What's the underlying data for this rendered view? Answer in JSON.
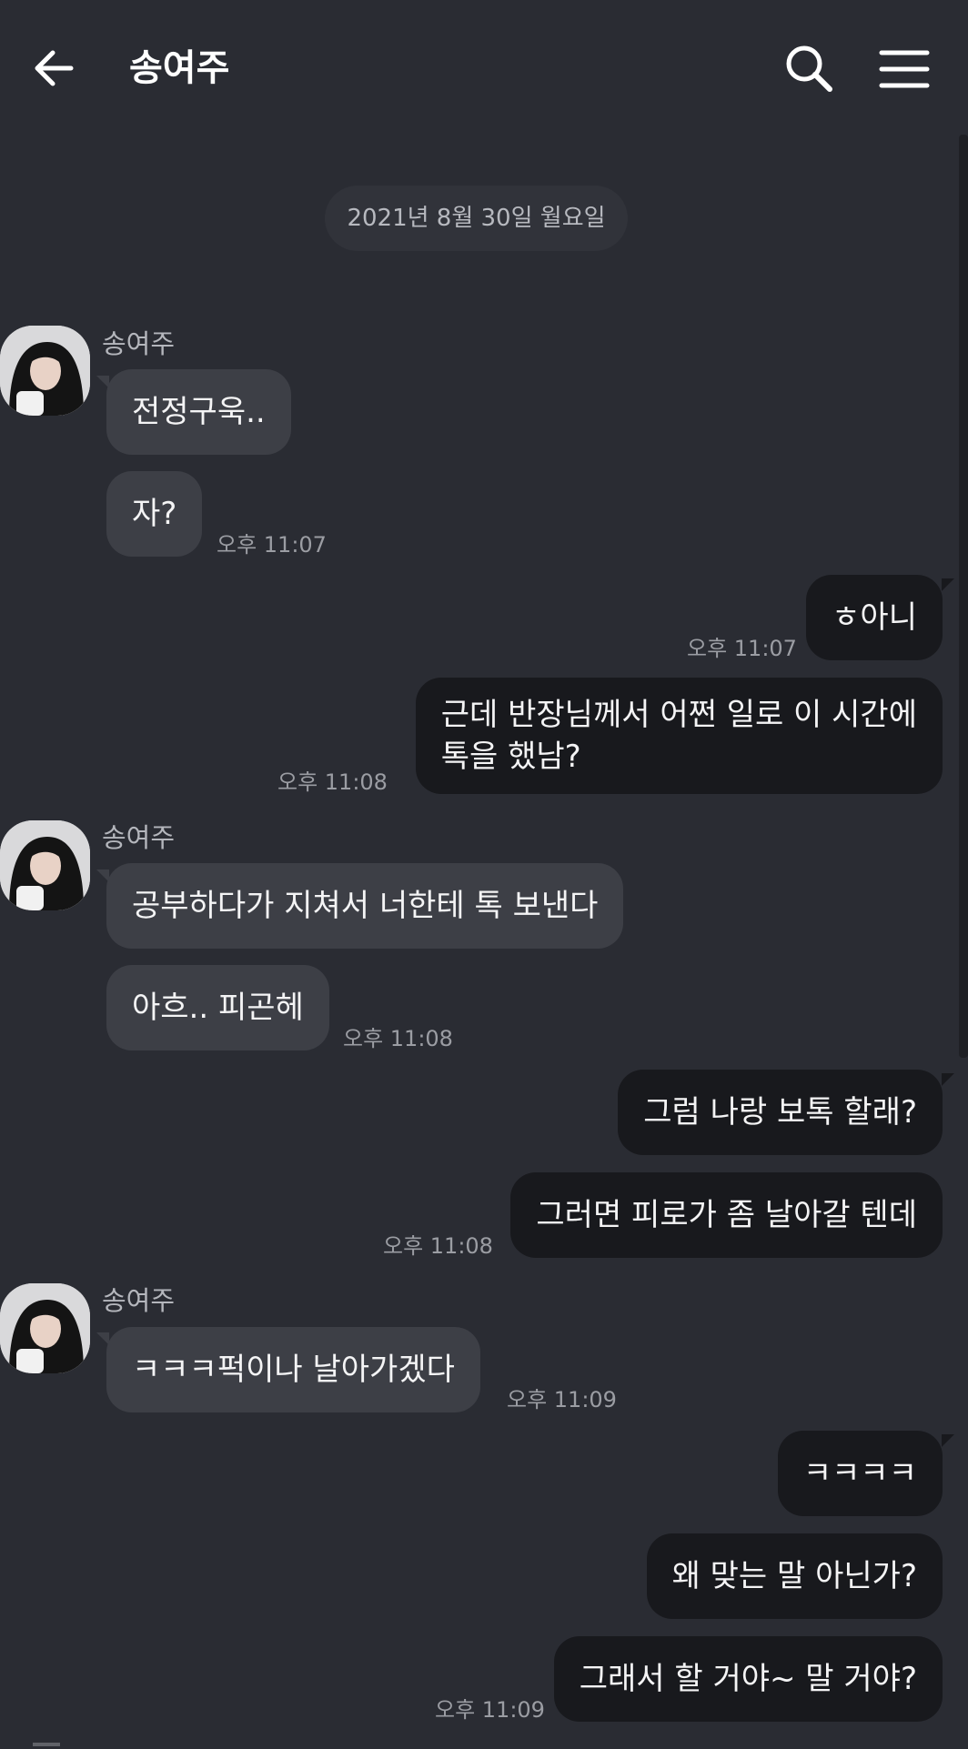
{
  "header": {
    "back_icon": "arrow-left-icon",
    "title": "송여주",
    "search_icon": "search-icon",
    "menu_icon": "hamburger-menu-icon"
  },
  "date_divider": "2021년 8월 30일 월요일",
  "colors": {
    "background": "#2a2c33",
    "incoming_bubble": "#3d3f46",
    "outgoing_bubble": "#18191d",
    "text": "#f4f4f5",
    "timestamp": "#9b9da3"
  },
  "messages": [
    {
      "sender": "송여주",
      "direction": "incoming",
      "text": "전정구욱..",
      "time": ""
    },
    {
      "sender": "송여주",
      "direction": "incoming",
      "text": "자?",
      "time": "오후 11:07"
    },
    {
      "sender": "me",
      "direction": "outgoing",
      "text": "ㅎ아니",
      "time": "오후 11:07"
    },
    {
      "sender": "me",
      "direction": "outgoing",
      "text_line1": "근데 반장님께서 어쩐 일로 이 시간에",
      "text_line2": "톡을 했남?",
      "time": "오후 11:08"
    },
    {
      "sender": "송여주",
      "direction": "incoming",
      "text": "공부하다가 지쳐서 너한테 톡 보낸다",
      "time": ""
    },
    {
      "sender": "송여주",
      "direction": "incoming",
      "text": "아흐.. 피곤헤",
      "time": "오후 11:08"
    },
    {
      "sender": "me",
      "direction": "outgoing",
      "text": "그럼 나랑 보톡 할래?",
      "time": ""
    },
    {
      "sender": "me",
      "direction": "outgoing",
      "text": "그러면 피로가 좀 날아갈 텐데",
      "time": "오후 11:08"
    },
    {
      "sender": "송여주",
      "direction": "incoming",
      "text": "ㅋㅋㅋ퍽이나 날아가겠다",
      "time": "오후 11:09"
    },
    {
      "sender": "me",
      "direction": "outgoing",
      "text": "ㅋㅋㅋㅋ",
      "time": ""
    },
    {
      "sender": "me",
      "direction": "outgoing",
      "text": "왜 맞는 말 아닌가?",
      "time": ""
    },
    {
      "sender": "me",
      "direction": "outgoing",
      "text": "그래서 할 거야~ 말 거야?",
      "time": "오후 11:09"
    }
  ],
  "groups": [
    {
      "sender_name": "송여주",
      "avatar": "profile-photo-avatar"
    },
    {
      "sender_name": "송여주",
      "avatar": "profile-photo-avatar"
    },
    {
      "sender_name": "송여주",
      "avatar": "profile-photo-avatar"
    }
  ]
}
